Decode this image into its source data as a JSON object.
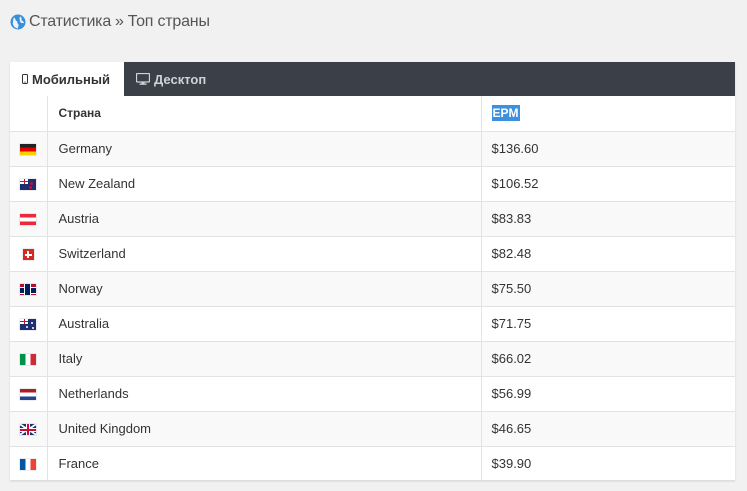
{
  "breadcrumb": {
    "root": "Статистика",
    "separator": "»",
    "current": "Топ страны"
  },
  "tabs": [
    {
      "label": "Мобильный",
      "icon": "mobile-icon",
      "active": true
    },
    {
      "label": "Десктоп",
      "icon": "desktop-icon",
      "active": false
    }
  ],
  "table": {
    "headers": {
      "country": "Страна",
      "epm": "EPM"
    },
    "rows": [
      {
        "flag": "de",
        "country": "Germany",
        "epm": "$136.60"
      },
      {
        "flag": "nz",
        "country": "New Zealand",
        "epm": "$106.52"
      },
      {
        "flag": "at",
        "country": "Austria",
        "epm": "$83.83"
      },
      {
        "flag": "ch",
        "country": "Switzerland",
        "epm": "$82.48"
      },
      {
        "flag": "no",
        "country": "Norway",
        "epm": "$75.50"
      },
      {
        "flag": "au",
        "country": "Australia",
        "epm": "$71.75"
      },
      {
        "flag": "it",
        "country": "Italy",
        "epm": "$66.02"
      },
      {
        "flag": "nl",
        "country": "Netherlands",
        "epm": "$56.99"
      },
      {
        "flag": "gb",
        "country": "United Kingdom",
        "epm": "$46.65"
      },
      {
        "flag": "fr",
        "country": "France",
        "epm": "$39.90"
      }
    ]
  },
  "colors": {
    "tab_bar": "#3a3f48",
    "highlight": "#3d8fe0",
    "globe": "#3a8fd9"
  }
}
